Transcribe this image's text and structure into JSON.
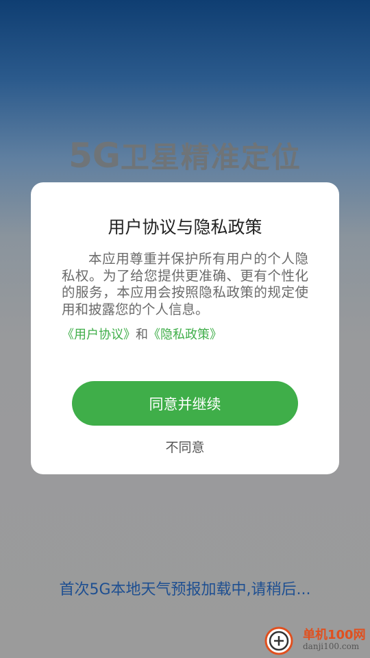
{
  "splash": {
    "title_prefix": "5G",
    "title_rest": "卫星精准定位",
    "loading_text": "首次5G本地天气预报加载中,请稍后..."
  },
  "dialog": {
    "title": "用户协议与隐私政策",
    "body": "本应用尊重并保护所有用户的个人隐私权。为了给您提供更准确、更有个性化的服务，本应用会按照隐私政策的规定使用和披露您的个人信息。",
    "user_agreement_link": "《用户协议》",
    "and_text": "和",
    "privacy_policy_link": "《隐私政策》",
    "agree_button": "同意并继续",
    "disagree_button": "不同意"
  },
  "watermark": {
    "name": "单机100网",
    "url": "danji100.com"
  },
  "colors": {
    "accent": "#3fae49",
    "loading_text": "#1e4f91",
    "title_gray": "#6f7478"
  }
}
